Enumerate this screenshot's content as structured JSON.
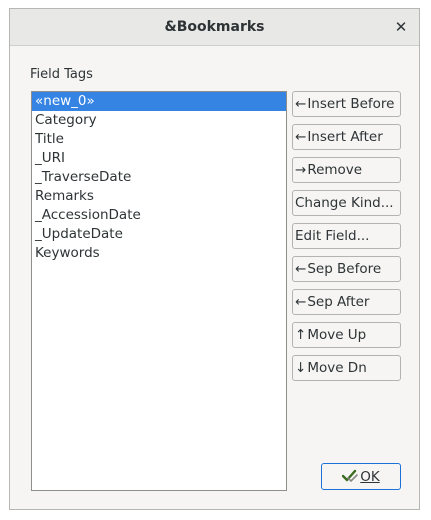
{
  "window": {
    "title": "&Bookmarks",
    "close_glyph": "✕"
  },
  "field_tags": {
    "label": "Field Tags",
    "items": [
      "«new_0»",
      "Category",
      "Title",
      "_URI",
      "_TraverseDate",
      "Remarks",
      "_AccessionDate",
      "_UpdateDate",
      "Keywords"
    ],
    "selected_index": 0
  },
  "buttons": [
    {
      "arrow": "←",
      "label": "Insert Before"
    },
    {
      "arrow": "←",
      "label": "Insert After"
    },
    {
      "arrow": "→",
      "label": "Remove"
    },
    {
      "arrow": "",
      "label": "Change Kind..."
    },
    {
      "arrow": "",
      "label": "Edit Field..."
    },
    {
      "arrow": "←",
      "label": "Sep Before"
    },
    {
      "arrow": "←",
      "label": "Sep After"
    },
    {
      "arrow": "↑",
      "label": "Move Up"
    },
    {
      "arrow": "↓",
      "label": "Move Dn"
    }
  ],
  "ok_button": {
    "label": "OK",
    "icon": "checkmark-hand-icon"
  },
  "colors": {
    "selection": "#3584e4",
    "ok_border": "#1c71d8"
  }
}
